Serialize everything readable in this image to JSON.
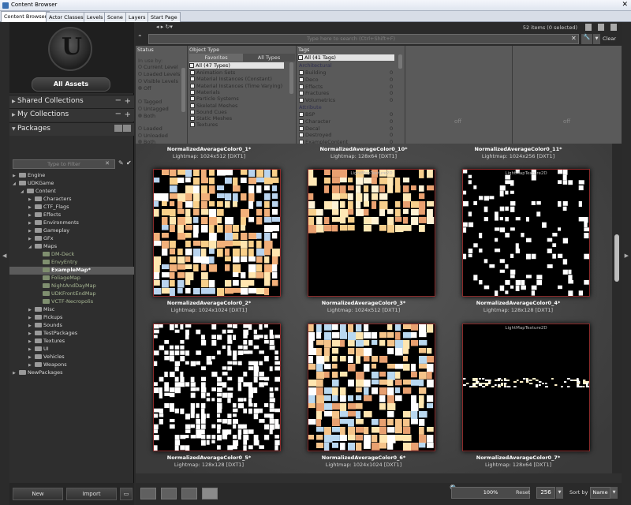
{
  "window": {
    "title": "Content Browser",
    "close_label": "✕"
  },
  "tabs": [
    {
      "label": "Content Browser"
    },
    {
      "label": "Actor Classes"
    },
    {
      "label": "Levels"
    },
    {
      "label": "Scene"
    },
    {
      "label": "Layers"
    },
    {
      "label": "Start Page"
    }
  ],
  "sidebar": {
    "all_assets": "All Assets",
    "shared_collections": "Shared Collections",
    "my_collections": "My Collections",
    "packages": "Packages",
    "filter_placeholder": "Type to Filter",
    "tree": [
      {
        "label": "Engine"
      },
      {
        "label": "UDKGame"
      },
      {
        "label": "Content"
      },
      {
        "label": "Characters"
      },
      {
        "label": "CTF_Flags"
      },
      {
        "label": "Effects"
      },
      {
        "label": "Environments"
      },
      {
        "label": "Gameplay"
      },
      {
        "label": "GFx"
      },
      {
        "label": "Maps"
      },
      {
        "label": "DM-Deck"
      },
      {
        "label": "EnvyEntry"
      },
      {
        "label": "ExampleMap*"
      },
      {
        "label": "FoliageMap"
      },
      {
        "label": "NightAndDayMap"
      },
      {
        "label": "UDKFrontEndMap"
      },
      {
        "label": "VCTF-Necropolis"
      },
      {
        "label": "Misc"
      },
      {
        "label": "Pickups"
      },
      {
        "label": "Sounds"
      },
      {
        "label": "TestPackages"
      },
      {
        "label": "Textures"
      },
      {
        "label": "UI"
      },
      {
        "label": "Vehicles"
      },
      {
        "label": "Weapons"
      },
      {
        "label": "NewPackages"
      }
    ],
    "new_button": "New",
    "import_button": "Import"
  },
  "toolbar": {
    "items_count": "52 items (0 selected)",
    "search_placeholder": "Type here to search (Ctrl+Shift+F)",
    "clear": "Clear"
  },
  "filters": {
    "status": {
      "header": "Status",
      "in_use_by": "In use by:",
      "options": [
        "Current Level",
        "Loaded Levels",
        "Visible Levels",
        "Off"
      ],
      "tag_opts": [
        "Tagged",
        "Untagged",
        "Both"
      ],
      "load_opts": [
        "Loaded",
        "Unloaded",
        "Both"
      ]
    },
    "object_type": {
      "header": "Object Type",
      "tab_favorites": "Favorites",
      "tab_all": "All Types",
      "all_label": "All (47 Types)",
      "items": [
        "Animation Sets",
        "Material Instances (Constant)",
        "Material Instances (Time Varying)",
        "Materials",
        "Particle Systems",
        "Skeletal Meshes",
        "Sound Cues",
        "Static Meshes",
        "Textures"
      ]
    },
    "tags": {
      "header": "Tags",
      "all_label": "All (41 Tags)",
      "group1": "Architectural",
      "group1_items": [
        "Building",
        "Deco",
        "Effects",
        "Fractures",
        "Volumetrics"
      ],
      "group2": "Attribute",
      "group2_items": [
        "BSP",
        "Character",
        "Decal",
        "Destroyed",
        "ExampleContent"
      ],
      "zero": "0"
    },
    "off1": "off",
    "off2": "off"
  },
  "assets": [
    {
      "name": "NormalizedAverageColor0_1*",
      "lightmap": "Lightmap: 1024x512 [DXT1]"
    },
    {
      "name": "NormalizedAverageColor0_10*",
      "lightmap": "Lightmap: 128x64 [DXT1]"
    },
    {
      "name": "NormalizedAverageColor0_11*",
      "lightmap": "Lightmap: 1024x256 [DXT1]"
    },
    {
      "name": "NormalizedAverageColor0_2*",
      "lightmap": "Lightmap: 1024x1024 [DXT1]",
      "thumb_title": ""
    },
    {
      "name": "NormalizedAverageColor0_3*",
      "lightmap": "Lightmap: 1024x512 [DXT1]",
      "thumb_title": "LightMapTexture2D"
    },
    {
      "name": "NormalizedAverageColor0_4*",
      "lightmap": "Lightmap: 128x128 [DXT1]",
      "thumb_title": "LightMapTexture2D"
    },
    {
      "name": "NormalizedAverageColor0_5*",
      "lightmap": "Lightmap: 128x128 [DXT1]",
      "thumb_title": ""
    },
    {
      "name": "NormalizedAverageColor0_6*",
      "lightmap": "Lightmap: 1024x1024 [DXT1]",
      "thumb_title": ""
    },
    {
      "name": "NormalizedAverageColor0_7*",
      "lightmap": "Lightmap: 128x64 [DXT1]",
      "thumb_title": "LightMapTexture2D"
    }
  ],
  "bottom": {
    "zoom": "100%",
    "reset": "Reset",
    "size": "256",
    "sort_label": "Sort by",
    "sort_value": "Name"
  }
}
